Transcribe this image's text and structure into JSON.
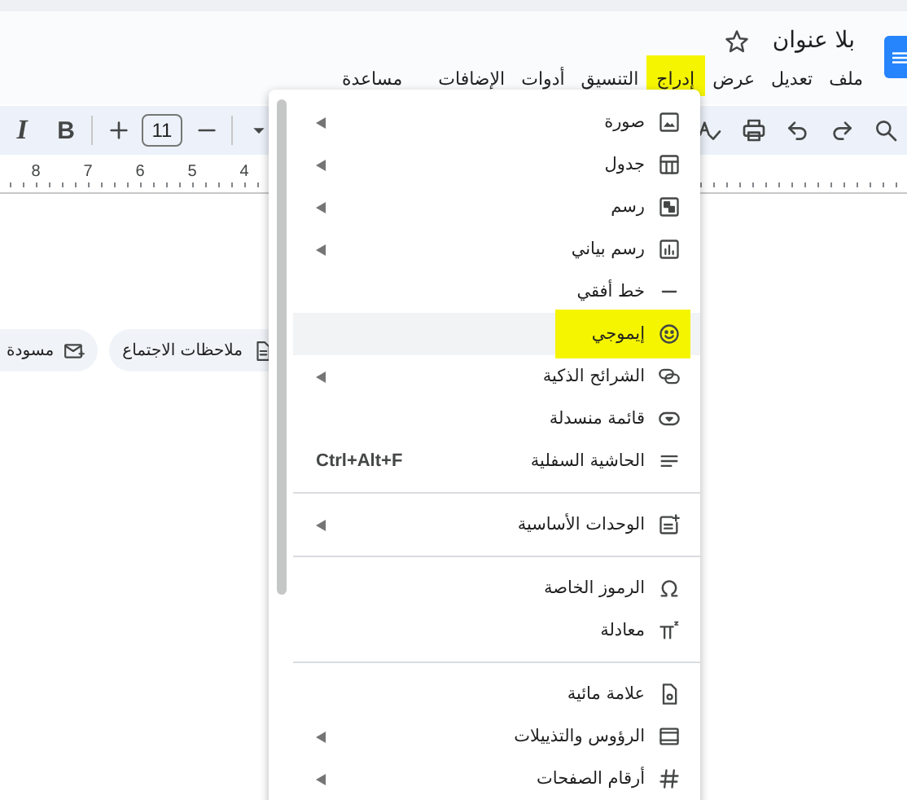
{
  "document": {
    "title": "بلا عنوان",
    "starred": false
  },
  "menu_bar": [
    {
      "label": "ملف",
      "highlighted": false
    },
    {
      "label": "تعديل",
      "highlighted": false
    },
    {
      "label": "عرض",
      "highlighted": false
    },
    {
      "label": "إدراج",
      "highlighted": true
    },
    {
      "label": "التنسيق",
      "highlighted": false
    },
    {
      "label": "أدوات",
      "highlighted": false
    },
    {
      "label": "الإضافات",
      "highlighted": false
    },
    {
      "label": "مساعدة",
      "highlighted": false
    }
  ],
  "toolbar": {
    "italic": "I",
    "bold": "B",
    "font_size": "11"
  },
  "ruler": {
    "numbers": [
      "4",
      "5",
      "6",
      "7",
      "8"
    ]
  },
  "chips": [
    {
      "label": "ملاحظات الاجتماع"
    },
    {
      "label": "مسودة"
    }
  ],
  "insert_menu": {
    "items": [
      {
        "kind": "item",
        "label": "صورة",
        "submenu": true,
        "hovered": false,
        "highlighted": false
      },
      {
        "kind": "item",
        "label": "جدول",
        "submenu": true,
        "hovered": false,
        "highlighted": false
      },
      {
        "kind": "item",
        "label": "رسم",
        "submenu": true,
        "hovered": false,
        "highlighted": false
      },
      {
        "kind": "item",
        "label": "رسم بياني",
        "submenu": true,
        "hovered": false,
        "highlighted": false
      },
      {
        "kind": "item",
        "label": "خط أفقي",
        "submenu": false,
        "hovered": false,
        "highlighted": false
      },
      {
        "kind": "item",
        "label": "إيموجي",
        "submenu": false,
        "hovered": true,
        "highlighted": true
      },
      {
        "kind": "item",
        "label": "الشرائح الذكية",
        "submenu": true,
        "hovered": false,
        "highlighted": false
      },
      {
        "kind": "item",
        "label": "قائمة منسدلة",
        "submenu": false,
        "hovered": false,
        "highlighted": false
      },
      {
        "kind": "item",
        "label": "الحاشية السفلية",
        "submenu": false,
        "hovered": false,
        "highlighted": false,
        "shortcut": "Ctrl+Alt+F"
      },
      {
        "kind": "divider"
      },
      {
        "kind": "item",
        "label": "الوحدات الأساسية",
        "submenu": true,
        "hovered": false,
        "highlighted": false
      },
      {
        "kind": "divider"
      },
      {
        "kind": "item",
        "label": "الرموز الخاصة",
        "submenu": false,
        "hovered": false,
        "highlighted": false
      },
      {
        "kind": "item",
        "label": "معادلة",
        "submenu": false,
        "hovered": false,
        "highlighted": false
      },
      {
        "kind": "divider"
      },
      {
        "kind": "item",
        "label": "علامة مائية",
        "submenu": false,
        "hovered": false,
        "highlighted": false
      },
      {
        "kind": "item",
        "label": "الرؤوس والتذييلات",
        "submenu": true,
        "hovered": false,
        "highlighted": false
      },
      {
        "kind": "item",
        "label": "أرقام الصفحات",
        "submenu": true,
        "hovered": false,
        "highlighted": false
      }
    ]
  }
}
